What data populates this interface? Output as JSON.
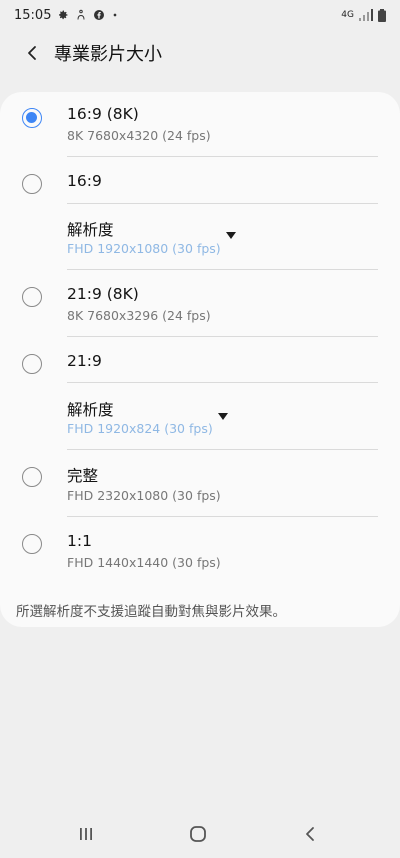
{
  "status": {
    "time": "15:05",
    "network": "4G"
  },
  "header": {
    "title": "專業影片大小"
  },
  "options": [
    {
      "title": "16:9 (8K)",
      "subtitle": "8K 7680x4320 (24 fps)",
      "selected": true
    },
    {
      "title": "16:9",
      "resolution_label": "解析度",
      "resolution_value": "FHD 1920x1080 (30 fps)",
      "selected": false
    },
    {
      "title": "21:9 (8K)",
      "subtitle": "8K 7680x3296 (24 fps)",
      "selected": false
    },
    {
      "title": "21:9",
      "resolution_label": "解析度",
      "resolution_value": "FHD 1920x824 (30 fps)",
      "selected": false
    },
    {
      "title": "完整",
      "subtitle": "FHD 2320x1080 (30 fps)",
      "selected": false
    },
    {
      "title": "1:1",
      "subtitle": "FHD 1440x1440 (30 fps)",
      "selected": false
    }
  ],
  "footer_note": "所選解析度不支援追蹤自動對焦與影片效果。",
  "colors": {
    "accent": "#3e86f5",
    "link_value": "#8fb8e4",
    "background": "#efefef",
    "card": "#fafafa"
  },
  "icons": {
    "status": [
      "settings-icon",
      "accessibility-icon",
      "facebook-icon",
      "notification-dot-icon",
      "signal-icon",
      "battery-icon"
    ],
    "nav": [
      "recent-apps-icon",
      "home-icon",
      "back-nav-icon"
    ]
  }
}
